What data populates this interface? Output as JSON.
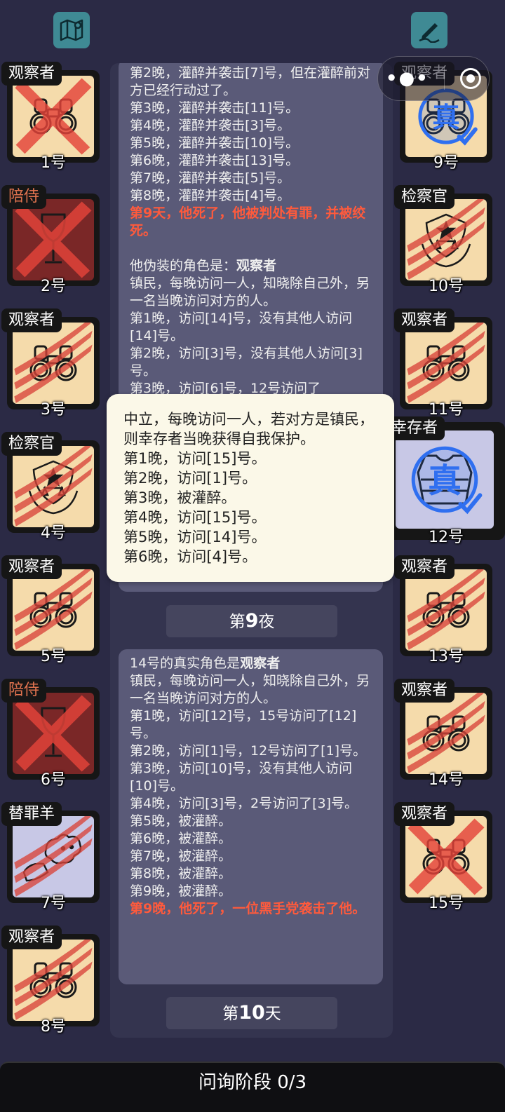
{
  "toolbar": {
    "map_icon": "map-icon",
    "notes_icon": "pen-icon"
  },
  "capsule": {
    "menu_icon": "more-dots-icon",
    "close_icon": "target-icon"
  },
  "players_left": [
    {
      "role": "观察者",
      "num": "1号",
      "face": "binoculars",
      "state": "crossed",
      "bg": "#f5dbab"
    },
    {
      "role": "陪侍",
      "num": "2号",
      "face": "wine-glass",
      "state": "crossed",
      "bg": "#7a2727",
      "red": true
    },
    {
      "role": "观察者",
      "num": "3号",
      "face": "binoculars",
      "state": "clawed",
      "bg": "#f5dbab"
    },
    {
      "role": "检察官",
      "num": "4号",
      "face": "badge",
      "state": "clawed",
      "bg": "#f5dbab"
    },
    {
      "role": "观察者",
      "num": "5号",
      "face": "binoculars",
      "state": "clawed",
      "bg": "#f5dbab"
    },
    {
      "role": "陪侍",
      "num": "6号",
      "face": "wine-glass",
      "state": "crossed",
      "bg": "#7a2727",
      "red": true
    },
    {
      "role": "替罪羊",
      "num": "7号",
      "face": "goat",
      "state": "clawed",
      "bg": "#c8c8e6"
    },
    {
      "role": "观察者",
      "num": "8号",
      "face": "binoculars",
      "state": "clawed",
      "bg": "#f5dbab"
    }
  ],
  "players_right": [
    {
      "role": "观察者",
      "num": "9号",
      "face": "binoculars",
      "state": "verified",
      "bg": "#f5dbab"
    },
    {
      "role": "检察官",
      "num": "10号",
      "face": "badge",
      "state": "clawed",
      "bg": "#f5dbab"
    },
    {
      "role": "观察者",
      "num": "11号",
      "face": "binoculars",
      "state": "clawed",
      "bg": "#f5dbab"
    },
    {
      "role": "幸存者",
      "num": "12号",
      "face": "vest",
      "state": "verified",
      "bg": "#c8c8e6",
      "active": true
    },
    {
      "role": "观察者",
      "num": "13号",
      "face": "binoculars",
      "state": "clawed",
      "bg": "#f5dbab"
    },
    {
      "role": "观察者",
      "num": "14号",
      "face": "binoculars",
      "state": "clawed",
      "bg": "#f5dbab"
    },
    {
      "role": "观察者",
      "num": "15号",
      "face": "binoculars",
      "state": "crossed",
      "bg": "#f5dbab"
    }
  ],
  "verified_stamp": "真",
  "log": {
    "msg1_lines": [
      "第2晚，灌醉并袭击[7]号，但在灌醉前对方已经行动过了。",
      "第3晚，灌醉并袭击[11]号。",
      "第4晚，灌醉并袭击[3]号。",
      "第5晚，灌醉并袭击[10]号。",
      "第6晚，灌醉并袭击[13]号。",
      "第7晚，灌醉并袭击[5]号。",
      "第8晚，灌醉并袭击[4]号。"
    ],
    "msg1_death": "第9天，他死了，他被判处有罪，并被绞死。",
    "msg1_fake_prefix": "他伪装的角色是：",
    "msg1_fake_role": "观察者",
    "msg1_lines2": [
      "镇民，每晚访问一人，知晓除自己外，另一名当晚访问对方的人。",
      "第1晚，访问[14]号，没有其他人访问[14]号。",
      "第2晚，访问[3]号，没有其他人访问[3]号。",
      "第3晚，访问[6]号，12号访问了"
    ],
    "day9_label_pre": "第",
    "day9_num": "9",
    "day9_label_post": "夜",
    "msg2_prefix": "14号的真实角色是",
    "msg2_role": "观察者",
    "msg2_lines": [
      "镇民，每晚访问一人，知晓除自己外，另一名当晚访问对方的人。",
      "第1晚，访问[12]号，15号访问了[12]号。",
      "第2晚，访问[1]号，12号访问了[1]号。",
      "第3晚，访问[10]号，没有其他人访问[10]号。",
      "第4晚，访问[3]号，2号访问了[3]号。",
      "第5晚，被灌醉。",
      "第6晚，被灌醉。",
      "第7晚，被灌醉。",
      "第8晚，被灌醉。",
      "第9晚，被灌醉。"
    ],
    "msg2_death": "第9晚，他死了，一位黑手党袭击了他。",
    "day10_label_pre": "第",
    "day10_num": "10",
    "day10_label_post": "天"
  },
  "popup": {
    "lines": [
      "中立，每晚访问一人，若对方是镇民，则幸存者当晚获得自我保护。",
      "第1晚，访问[15]号。",
      "第2晚，访问[1]号。",
      "第3晚，被灌醉。",
      "第4晚，访问[15]号。",
      "第5晚，访问[14]号。",
      "第6晚，访问[4]号。"
    ]
  },
  "phase": {
    "label": "问询阶段 0/3"
  }
}
